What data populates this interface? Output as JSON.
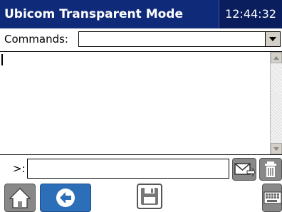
{
  "window": {
    "title": "Ubicom Transparent Mode",
    "clock": "12:44:32"
  },
  "commands": {
    "label": "Commands:",
    "selected": ""
  },
  "output": {
    "text": ""
  },
  "send": {
    "prompt": ">:",
    "value": ""
  },
  "icons": {
    "dropdown": "chevron-down-icon",
    "scroll_up": "scroll-up-arrow-icon",
    "scroll_down": "scroll-down-arrow-icon",
    "send": "envelope-arrow-icon",
    "clear": "trash-icon",
    "home": "home-icon",
    "back": "back-arrow-icon",
    "save": "floppy-disk-icon",
    "keyboard": "keyboard-icon"
  },
  "colors": {
    "titlebar": "#0f2a78",
    "back_button": "#2d6eb8",
    "icon_button": "#888888"
  }
}
